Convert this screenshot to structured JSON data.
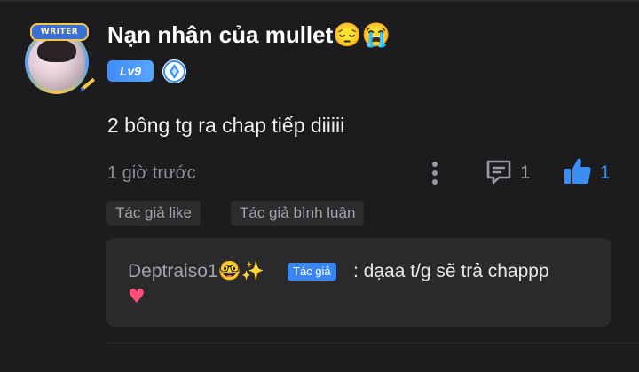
{
  "comment": {
    "avatar": {
      "badge_label": "WRITER",
      "icon": "writer-pen-icon"
    },
    "username": "Nạn nhân của mullet😔😭",
    "level_badge": "Lv9",
    "level_icon": "diamond-icon",
    "text": "2 bông tg ra chap tiếp diiiii",
    "time": "1 giờ trước",
    "reply_count": "1",
    "like_count": "1",
    "tags": [
      "Tác giả like",
      "Tác giả bình luận"
    ],
    "colors": {
      "background": "#1c1c1e",
      "accent_blue": "#3b8ff3",
      "muted_text": "#8e8e93",
      "reply_box": "#2a2a2c"
    }
  },
  "reply": {
    "author": "Deptraiso1🤓✨",
    "author_badge": "Tác giả",
    "text": ": dạaa t/g sẽ trả chappp",
    "heart": "♥"
  }
}
